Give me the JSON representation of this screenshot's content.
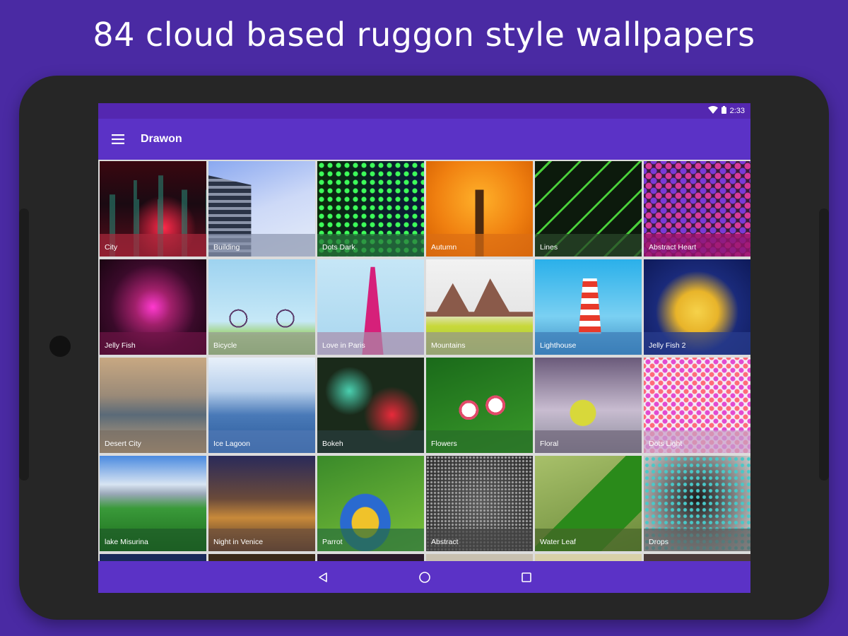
{
  "headline": "84 cloud based ruggon style wallpapers",
  "status": {
    "time": "2:33",
    "icons": [
      "wifi-icon",
      "battery-icon"
    ]
  },
  "app": {
    "title": "Drawon",
    "menu_icon": "menu-icon"
  },
  "colors": {
    "background": "#4a2aa3",
    "appbar": "#5b32c6",
    "statusbar": "#5427b0",
    "device": "#262626"
  },
  "wallpapers": [
    {
      "label": "City"
    },
    {
      "label": "Building"
    },
    {
      "label": "Dots Dark"
    },
    {
      "label": "Autumn"
    },
    {
      "label": "Lines"
    },
    {
      "label": "Abstract Heart"
    },
    {
      "label": "Jelly Fish"
    },
    {
      "label": "Bicycle"
    },
    {
      "label": "Love in Paris"
    },
    {
      "label": "Mountains"
    },
    {
      "label": "Lighthouse"
    },
    {
      "label": "Jelly Fish 2"
    },
    {
      "label": "Desert City"
    },
    {
      "label": "Ice Lagoon"
    },
    {
      "label": "Bokeh"
    },
    {
      "label": "Flowers"
    },
    {
      "label": "Floral"
    },
    {
      "label": "Dots Light"
    },
    {
      "label": "lake Misurina"
    },
    {
      "label": "Night in Venice"
    },
    {
      "label": "Parrot"
    },
    {
      "label": "Abstract"
    },
    {
      "label": "Water Leaf"
    },
    {
      "label": "Drops"
    }
  ],
  "navigation": {
    "back_icon": "back-triangle-icon",
    "home_icon": "home-circle-icon",
    "recents_icon": "recents-square-icon"
  }
}
